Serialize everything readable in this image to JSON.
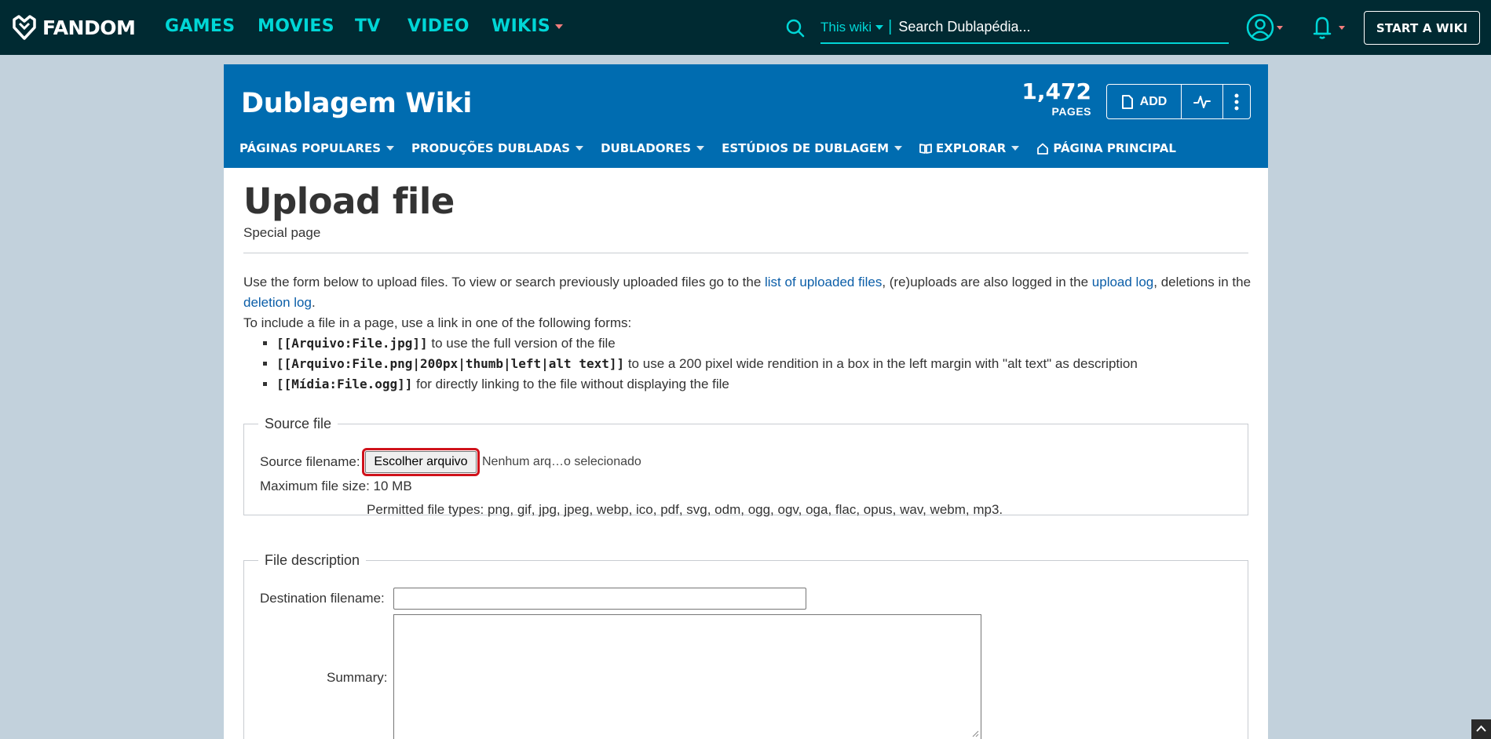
{
  "global_nav": {
    "logo_text": "FANDOM",
    "links": [
      "GAMES",
      "MOVIES",
      "TV",
      "VIDEO",
      "WIKIS"
    ],
    "search_scope": "This wiki",
    "search_placeholder": "Search Dublapédia...",
    "start_wiki": "START A WIKI"
  },
  "wiki": {
    "name": "Dublagem Wiki",
    "pages_count": "1,472",
    "pages_label": "PAGES",
    "add_label": "ADD",
    "nav": [
      "PÁGINAS POPULARES",
      "PRODUÇÕES DUBLADAS",
      "DUBLADORES",
      "ESTÚDIOS DE DUBLAGEM",
      "EXPLORAR",
      "PÁGINA PRINCIPAL"
    ]
  },
  "page": {
    "title": "Upload file",
    "subtitle": "Special page",
    "intro_1": "Use the form below to upload files. To view or search previously uploaded files go to the ",
    "link_uploaded": "list of uploaded files",
    "intro_2": ", (re)uploads are also logged in the ",
    "link_upload_log": "upload log",
    "intro_3": ", deletions in the ",
    "link_deletion_log": "deletion log",
    "intro_4": ".",
    "include_line": "To include a file in a page, use a link in one of the following forms:",
    "forms": [
      {
        "code": "[[Arquivo:File.jpg]]",
        "desc": " to use the full version of the file"
      },
      {
        "code": "[[Arquivo:File.png|200px|thumb|left|alt text]]",
        "desc": " to use a 200 pixel wide rendition in a box in the left margin with \"alt text\" as description"
      },
      {
        "code": "[[Mídia:File.ogg]]",
        "desc": " for directly linking to the file without displaying the file"
      }
    ]
  },
  "source_file": {
    "legend": "Source file",
    "filename_label": "Source filename:",
    "choose_button": "Escolher arquivo",
    "no_file": "Nenhum arq…o selecionado",
    "max_size": "Maximum file size: 10 MB",
    "permitted": "Permitted file types: png, gif, jpg, jpeg, webp, ico, pdf, svg, odm, ogg, ogv, oga, flac, opus, wav, webm, mp3."
  },
  "file_description": {
    "legend": "File description",
    "dest_label": "Destination filename:",
    "dest_value": "",
    "summary_label": "Summary:"
  },
  "colors": {
    "global_nav_bg": "#002a32",
    "accent_teal": "#00d6d6",
    "wiki_header_bg": "#006cb0",
    "link": "#0b5ea8",
    "highlight": "#d0121b"
  }
}
